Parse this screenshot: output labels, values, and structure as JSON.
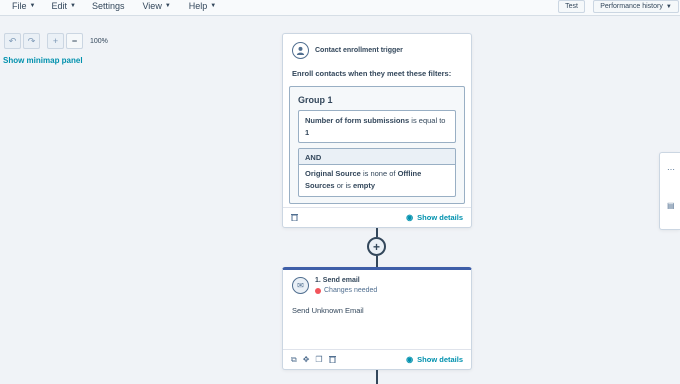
{
  "menu": [
    {
      "label": "File",
      "caret": true
    },
    {
      "label": "Edit",
      "caret": true
    },
    {
      "label": "Settings",
      "caret": false
    },
    {
      "label": "View",
      "caret": true
    },
    {
      "label": "Help",
      "caret": true
    }
  ],
  "toolbar": {
    "test_label": "Test",
    "performance_label": "Performance history"
  },
  "zoom": {
    "level": "100%"
  },
  "minimap_label": "Show minimap panel",
  "trigger": {
    "title": "Contact enrollment trigger",
    "enroll_text": "Enroll contacts when they meet these filters:",
    "group_title": "Group 1",
    "filter1": {
      "property": "Number of form submissions",
      "operator": " is equal to ",
      "value": "1"
    },
    "and_label": "AND",
    "filter2": {
      "property": "Original Source",
      "operator": " is none of ",
      "value1": "Offline Sources",
      "connector": " or is ",
      "value2": "empty"
    },
    "show_details": "Show details"
  },
  "email_action": {
    "title": "1. Send email",
    "status": "Changes needed",
    "body": "Send Unknown Email",
    "show_details": "Show details"
  },
  "colors": {
    "accent": "#0091ae",
    "action_bar": "#3e5ea8",
    "status_red": "#f2545b",
    "text": "#33475b"
  }
}
